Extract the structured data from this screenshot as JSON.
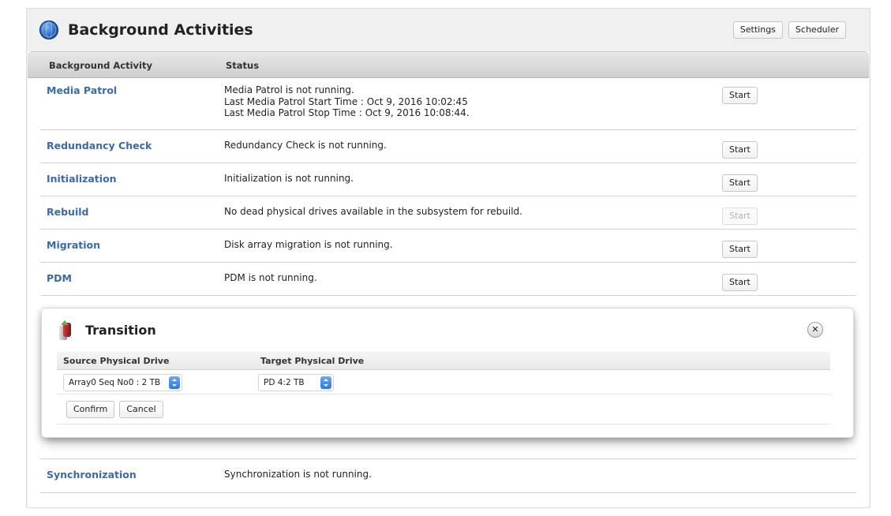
{
  "header": {
    "title": "Background Activities",
    "settings_label": "Settings",
    "scheduler_label": "Scheduler",
    "icon": "globe-icon"
  },
  "table": {
    "columns": [
      "Background Activity",
      "Status"
    ],
    "rows": [
      {
        "name": "Media Patrol",
        "status_lines": [
          "Media Patrol is not running.",
          "Last Media Patrol Start Time : Oct 9, 2016 10:02:45",
          "Last Media Patrol Stop Time : Oct 9, 2016 10:08:44."
        ],
        "action": "Start",
        "action_enabled": true
      },
      {
        "name": "Redundancy Check",
        "status_lines": [
          "Redundancy Check is not running."
        ],
        "action": "Start",
        "action_enabled": true
      },
      {
        "name": "Initialization",
        "status_lines": [
          "Initialization is not running."
        ],
        "action": "Start",
        "action_enabled": true
      },
      {
        "name": "Rebuild",
        "status_lines": [
          "No dead physical drives available in the subsystem for rebuild."
        ],
        "action": "Start",
        "action_enabled": false
      },
      {
        "name": "Migration",
        "status_lines": [
          "Disk array migration is not running."
        ],
        "action": "Start",
        "action_enabled": true
      },
      {
        "name": "PDM",
        "status_lines": [
          "PDM is not running."
        ],
        "action": "Start",
        "action_enabled": true
      }
    ],
    "last_row": {
      "name": "Synchronization",
      "status_lines": [
        "Synchronization is not running."
      ]
    }
  },
  "transition": {
    "title": "Transition",
    "icon": "drive-transition-icon",
    "close_icon": "close-icon",
    "columns": [
      "Source Physical Drive",
      "Target Physical Drive"
    ],
    "source_value": "Array0 Seq No0 : 2 TB",
    "target_value": "PD 4:2 TB",
    "confirm_label": "Confirm",
    "cancel_label": "Cancel"
  },
  "colors": {
    "link": "#3c6aa3",
    "stepper": "#2f78d8"
  }
}
